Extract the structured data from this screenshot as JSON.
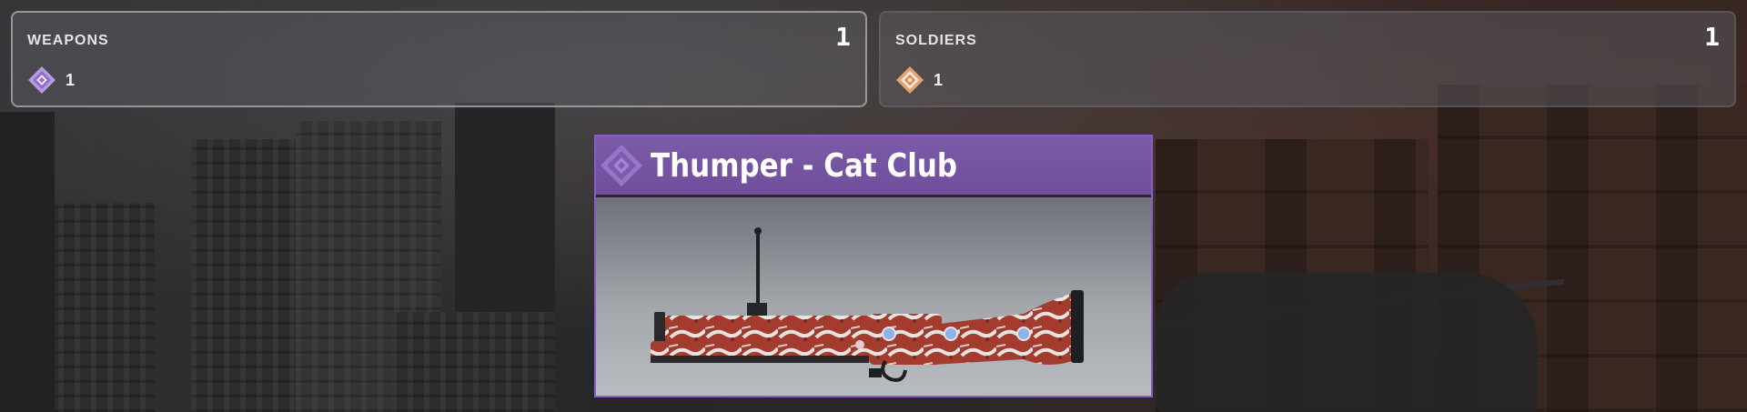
{
  "stats": {
    "weapons": {
      "label": "WEAPONS",
      "total": "1",
      "icon": "diamond-rarity-icon-purple",
      "count": "1",
      "accent": "#b79be0"
    },
    "soldiers": {
      "label": "SOLDIERS",
      "total": "1",
      "icon": "diamond-rarity-icon-orange",
      "count": "1",
      "accent": "#e2a46f"
    }
  },
  "item": {
    "title": "Thumper - Cat Club",
    "rarity_icon": "diamond-rarity-icon-purple",
    "rarity_color": "#7b5aa8",
    "image": "grenade-launcher-skin"
  }
}
